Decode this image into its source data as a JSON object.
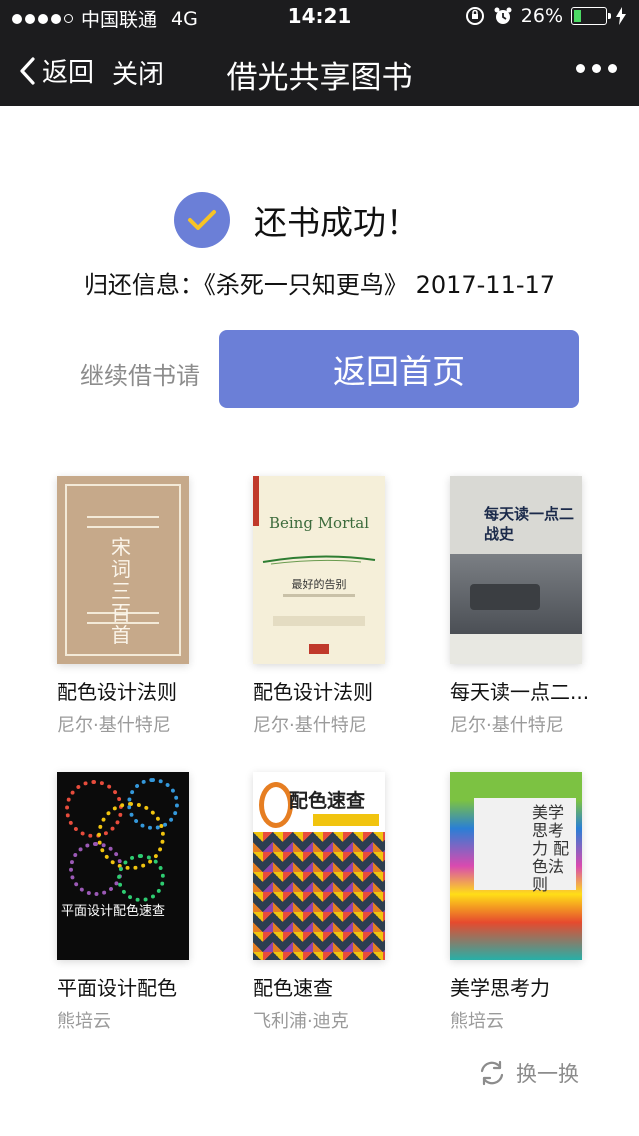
{
  "status_bar": {
    "carrier": "中国联通",
    "network": "4G",
    "time": "14:21",
    "battery": "26%",
    "battery_level": 0.26
  },
  "nav": {
    "back_label": "返回",
    "close_label": "关闭",
    "title": "借光共享图书"
  },
  "result": {
    "message": "还书成功！",
    "info": "归还信息：《杀死一只知更鸟》 2017-11-17"
  },
  "actions": {
    "continue_text": "继续借书请",
    "home_button": "返回首页"
  },
  "books": [
    {
      "title": "配色设计法则",
      "author": "尼尔·基什特尼",
      "cover_text": "宋词三百首"
    },
    {
      "title": "配色设计法则",
      "author": "尼尔·基什特尼",
      "cover_text_en": "Being Mortal",
      "cover_text": "最好的告别"
    },
    {
      "title": "每天读一点二...",
      "author": "尼尔·基什特尼",
      "cover_text": "每天读一点二战史"
    },
    {
      "title": "平面设计配色",
      "author": "熊培云",
      "cover_text": "平面设计配色速查"
    },
    {
      "title": "配色速查",
      "author": "飞利浦·迪克",
      "cover_text": "配色速查"
    },
    {
      "title": "美学思考力",
      "author": "熊培云",
      "cover_text": "美学思考力 配色法则"
    }
  ],
  "footer": {
    "swap_label": "换一换"
  },
  "colors": {
    "accent": "#6b7fd7",
    "check": "#f7c325",
    "nav_bg": "#1c1c1e"
  }
}
